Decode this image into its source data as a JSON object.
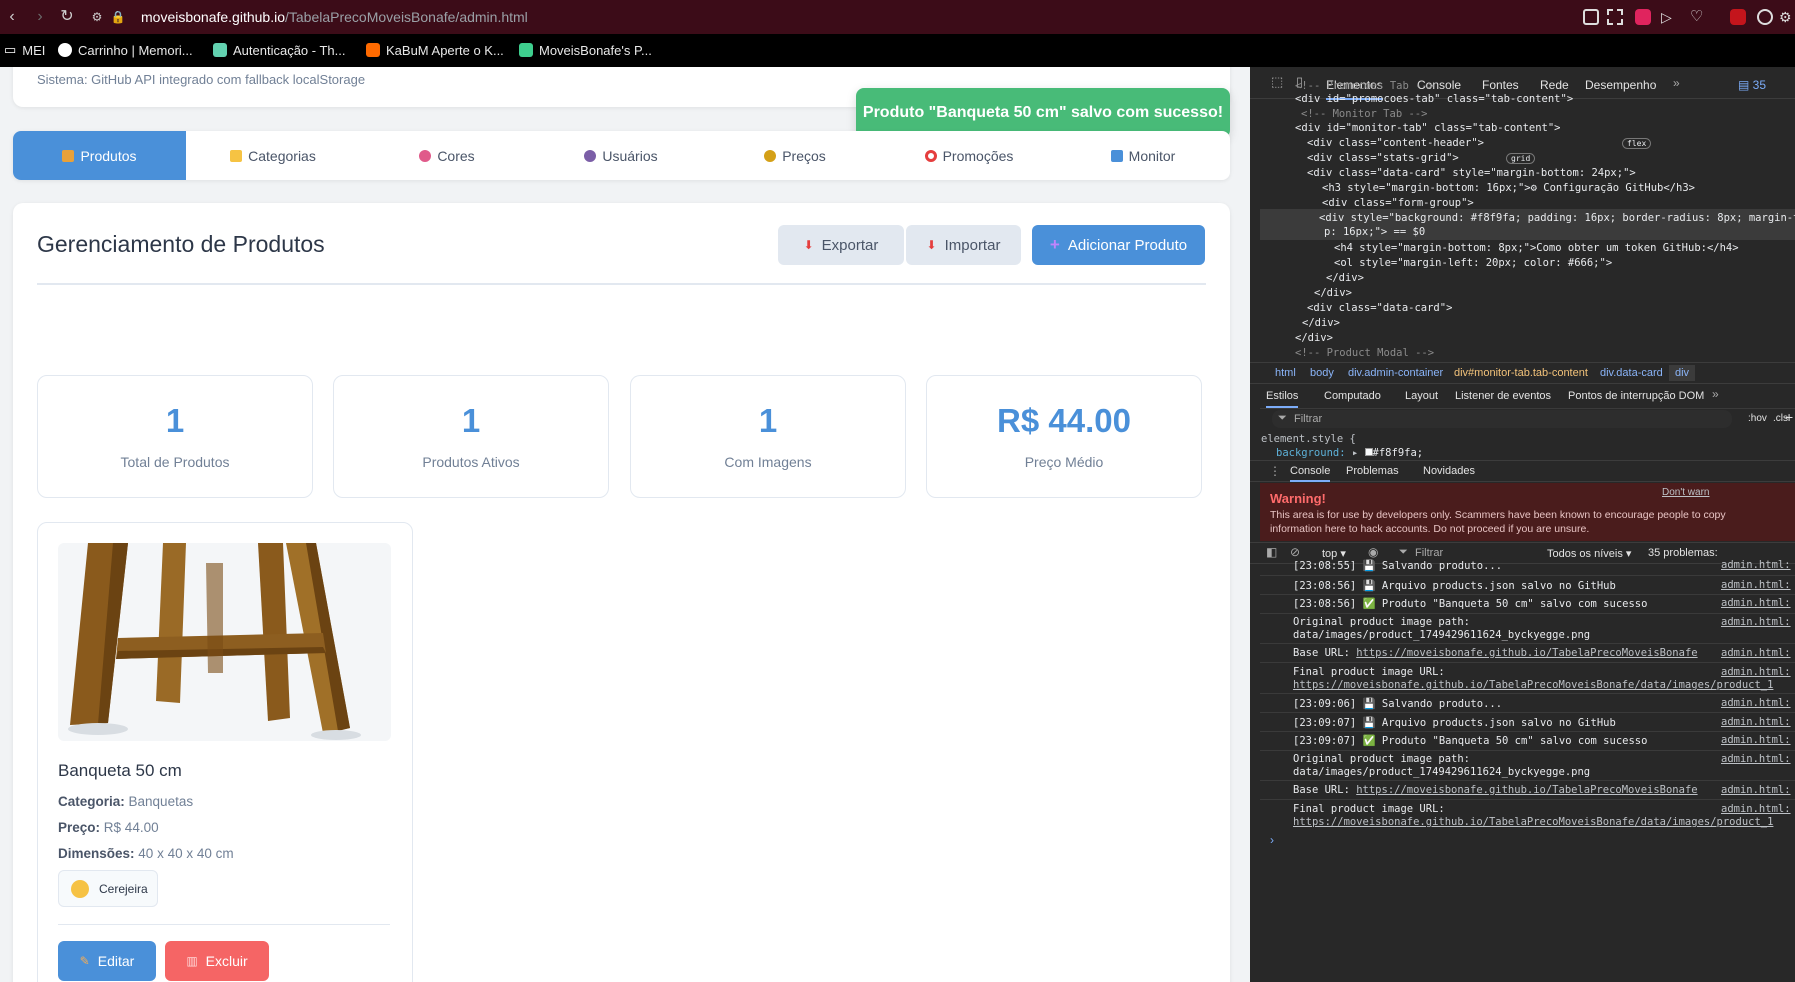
{
  "browser": {
    "url_host": "moveisbonafe.github.io",
    "url_path": "/TabelaPrecoMoveisBonafe/admin.html",
    "bookmarks": [
      {
        "label": "MEI",
        "icon": "folder-icon",
        "color": "#ffffff"
      },
      {
        "label": "Carrinho | Memori...",
        "icon": "site-icon",
        "color": "#ffffff"
      },
      {
        "label": "Autenticação - Th...",
        "icon": "site-icon",
        "color": "#62d1b0"
      },
      {
        "label": "KaBuM Aperte o K...",
        "icon": "site-icon",
        "color": "#ff6a00"
      },
      {
        "label": "MoveisBonafe's P...",
        "icon": "site-icon",
        "color": "#3ecf8e"
      }
    ]
  },
  "page": {
    "header_subtitle": "Sistema: GitHub API integrado com fallback localStorage",
    "toast": "Produto \"Banqueta 50 cm\" salvo com sucesso!",
    "tabs": [
      {
        "label": "Produtos",
        "icon": "box-icon",
        "color": "#e8a13a"
      },
      {
        "label": "Categorias",
        "icon": "folder-icon",
        "color": "#f6c343"
      },
      {
        "label": "Cores",
        "icon": "palette-icon",
        "color": "#e05a8a"
      },
      {
        "label": "Usuários",
        "icon": "users-icon",
        "color": "#7b5ea7"
      },
      {
        "label": "Preços",
        "icon": "money-bag-icon",
        "color": "#d4a017"
      },
      {
        "label": "Promoções",
        "icon": "target-icon",
        "color": "#e53e3e"
      },
      {
        "label": "Monitor",
        "icon": "chart-icon",
        "color": "#4a90d9"
      }
    ],
    "section_title": "Gerenciamento de Produtos",
    "export_label": "Exportar",
    "import_label": "Importar",
    "add_label": "Adicionar Produto",
    "stats": [
      {
        "value": "1",
        "label": "Total de Produtos"
      },
      {
        "value": "1",
        "label": "Produtos Ativos"
      },
      {
        "value": "1",
        "label": "Com Imagens"
      },
      {
        "value": "R$ 44.00",
        "label": "Preço Médio"
      }
    ],
    "product": {
      "name": "Banqueta 50 cm",
      "category_label": "Categoria:",
      "category": "Banquetas",
      "price_label": "Preço:",
      "price": "R$ 44.00",
      "dims_label": "Dimensões:",
      "dims": "40 x 40 x 40 cm",
      "color_name": "Cerejeira",
      "color_hex": "#f6c244",
      "edit_label": "Editar",
      "delete_label": "Excluir"
    }
  },
  "devtools": {
    "tabs": [
      "Elementos",
      "Console",
      "Fontes",
      "Rede",
      "Desempenho"
    ],
    "issues_count": "35",
    "dom_lines": [
      "<div id=\"promocoes-tab\" class=\"tab-content\">",
      "<!-- Monitor Tab -->",
      "<div id=\"monitor-tab\" class=\"tab-content\">",
      "<div class=\"content-header\">",
      "<div class=\"stats-grid\">",
      "<div class=\"data-card\" style=\"margin-bottom: 24px;\">",
      "<h3 style=\"margin-bottom: 16px;\">⚙ Configuração GitHub</h3>",
      "<div class=\"form-group\">",
      "<div style=\"background: #f8f9fa; padding: 16px; border-radius: 8px; margin-to",
      "p: 16px;\"> == $0",
      "<h4 style=\"margin-bottom: 8px;\">Como obter um token GitHub:</h4>",
      "<ol style=\"margin-left: 20px; color: #666;\">",
      "</div>",
      "</div>",
      "<div class=\"data-card\">",
      "</div>",
      "</div>",
      "<!-- Product Modal -->"
    ],
    "badges": {
      "flex": "flex",
      "grid": "grid"
    },
    "breadcrumb": [
      "html",
      "body",
      "div.admin-container",
      "div#monitor-tab.tab-content",
      "div.data-card",
      "div"
    ],
    "style_tabs": [
      "Estilos",
      "Computado",
      "Layout",
      "Listener de eventos",
      "Pontos de interrupção DOM"
    ],
    "filter_placeholder": "Filtrar",
    "hov": ":hov",
    "cls": ".cls",
    "element_style": "element.style {",
    "bg_prop": "background:",
    "bg_value": "#f8f9fa;",
    "drawer_tabs": [
      "Console",
      "Problemas",
      "Novidades"
    ],
    "warning_title": "Warning!",
    "dont_warn": "Don't warn",
    "warning_text_1": "This area is for use by developers only. Scammers have been known to encourage people to copy",
    "warning_text_2": "information here to hack accounts. Do not proceed if you are unsure.",
    "context": "top ▾",
    "levels": "Todos os níveis ▾",
    "problems": "35 problemas:",
    "console_lines": [
      {
        "text": "[23:08:55] 💾 Salvando produto...",
        "src": "admin.html:"
      },
      {
        "text": "[23:08:56] 💾 Arquivo products.json salvo no GitHub",
        "src": "admin.html:"
      },
      {
        "text": "[23:08:56] ✅ Produto \"Banqueta 50 cm\" salvo com sucesso",
        "src": "admin.html:"
      },
      {
        "text": "Original product image path:",
        "text2": "data/images/product_1749429611624_byckyegge.png",
        "src": "admin.html:"
      },
      {
        "text": "Base URL: ",
        "link": "https://moveisbonafe.github.io/TabelaPrecoMoveisBonafe",
        "src": "admin.html:"
      },
      {
        "text": "Final product image URL:",
        "text2": "https://moveisbonafe.github.io/TabelaPrecoMoveisBonafe/data/images/product_1",
        "src": "admin.html:"
      },
      {
        "text": "[23:09:06] 💾 Salvando produto...",
        "src": "admin.html:"
      },
      {
        "text": "[23:09:07] 💾 Arquivo products.json salvo no GitHub",
        "src": "admin.html:"
      },
      {
        "text": "[23:09:07] ✅ Produto \"Banqueta 50 cm\" salvo com sucesso",
        "src": "admin.html:"
      },
      {
        "text": "Original product image path:",
        "text2": "data/images/product_1749429611624_byckyegge.png",
        "src": "admin.html:"
      },
      {
        "text": "Base URL: ",
        "link": "https://moveisbonafe.github.io/TabelaPrecoMoveisBonafe",
        "src": "admin.html:"
      },
      {
        "text": "Final product image URL:",
        "text2": "https://moveisbonafe.github.io/TabelaPrecoMoveisBonafe/data/images/product_1",
        "src": "admin.html:"
      }
    ]
  }
}
